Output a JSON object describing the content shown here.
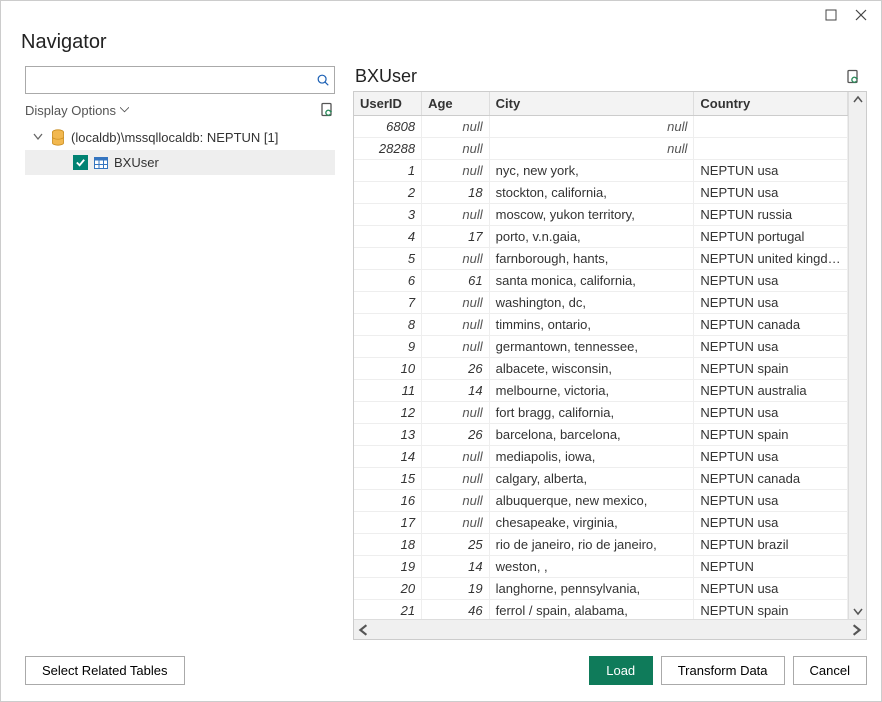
{
  "title": "Navigator",
  "search": {
    "placeholder": ""
  },
  "displayOptions": {
    "label": "Display Options"
  },
  "tree": {
    "root": {
      "label": "(localdb)\\mssqllocaldb: NEPTUN [1]"
    },
    "child": {
      "label": "BXUser",
      "checked": true
    }
  },
  "preview": {
    "title": "BXUser",
    "columns": [
      "UserID",
      "Age",
      "City",
      "Country"
    ],
    "rows": [
      {
        "UserID": "6808",
        "Age": null,
        "City": null,
        "Country": ""
      },
      {
        "UserID": "28288",
        "Age": null,
        "City": null,
        "Country": ""
      },
      {
        "UserID": "1",
        "Age": null,
        "City": "nyc, new york,",
        "Country": "NEPTUN usa"
      },
      {
        "UserID": "2",
        "Age": 18,
        "City": "stockton, california,",
        "Country": "NEPTUN usa"
      },
      {
        "UserID": "3",
        "Age": null,
        "City": "moscow, yukon territory,",
        "Country": "NEPTUN russia"
      },
      {
        "UserID": "4",
        "Age": 17,
        "City": "porto, v.n.gaia,",
        "Country": "NEPTUN portugal"
      },
      {
        "UserID": "5",
        "Age": null,
        "City": "farnborough, hants,",
        "Country": "NEPTUN united kingdom"
      },
      {
        "UserID": "6",
        "Age": 61,
        "City": "santa monica, california,",
        "Country": "NEPTUN usa"
      },
      {
        "UserID": "7",
        "Age": null,
        "City": "washington, dc,",
        "Country": "NEPTUN usa"
      },
      {
        "UserID": "8",
        "Age": null,
        "City": "timmins, ontario,",
        "Country": "NEPTUN canada"
      },
      {
        "UserID": "9",
        "Age": null,
        "City": "germantown, tennessee,",
        "Country": "NEPTUN usa"
      },
      {
        "UserID": "10",
        "Age": 26,
        "City": "albacete, wisconsin,",
        "Country": "NEPTUN spain"
      },
      {
        "UserID": "11",
        "Age": 14,
        "City": "melbourne, victoria,",
        "Country": "NEPTUN australia"
      },
      {
        "UserID": "12",
        "Age": null,
        "City": "fort bragg, california,",
        "Country": "NEPTUN usa"
      },
      {
        "UserID": "13",
        "Age": 26,
        "City": "barcelona, barcelona,",
        "Country": "NEPTUN spain"
      },
      {
        "UserID": "14",
        "Age": null,
        "City": "mediapolis, iowa,",
        "Country": "NEPTUN usa"
      },
      {
        "UserID": "15",
        "Age": null,
        "City": "calgary, alberta,",
        "Country": "NEPTUN canada"
      },
      {
        "UserID": "16",
        "Age": null,
        "City": "albuquerque, new mexico,",
        "Country": "NEPTUN usa"
      },
      {
        "UserID": "17",
        "Age": null,
        "City": "chesapeake, virginia,",
        "Country": "NEPTUN usa"
      },
      {
        "UserID": "18",
        "Age": 25,
        "City": "rio de janeiro, rio de janeiro,",
        "Country": "NEPTUN brazil"
      },
      {
        "UserID": "19",
        "Age": 14,
        "City": "weston, ,",
        "Country": "NEPTUN"
      },
      {
        "UserID": "20",
        "Age": 19,
        "City": "langhorne, pennsylvania,",
        "Country": "NEPTUN usa"
      },
      {
        "UserID": "21",
        "Age": 46,
        "City": "ferrol / spain, alabama,",
        "Country": "NEPTUN spain"
      }
    ]
  },
  "buttons": {
    "selectRelated": "Select Related Tables",
    "load": "Load",
    "transform": "Transform Data",
    "cancel": "Cancel"
  },
  "nullText": "null"
}
